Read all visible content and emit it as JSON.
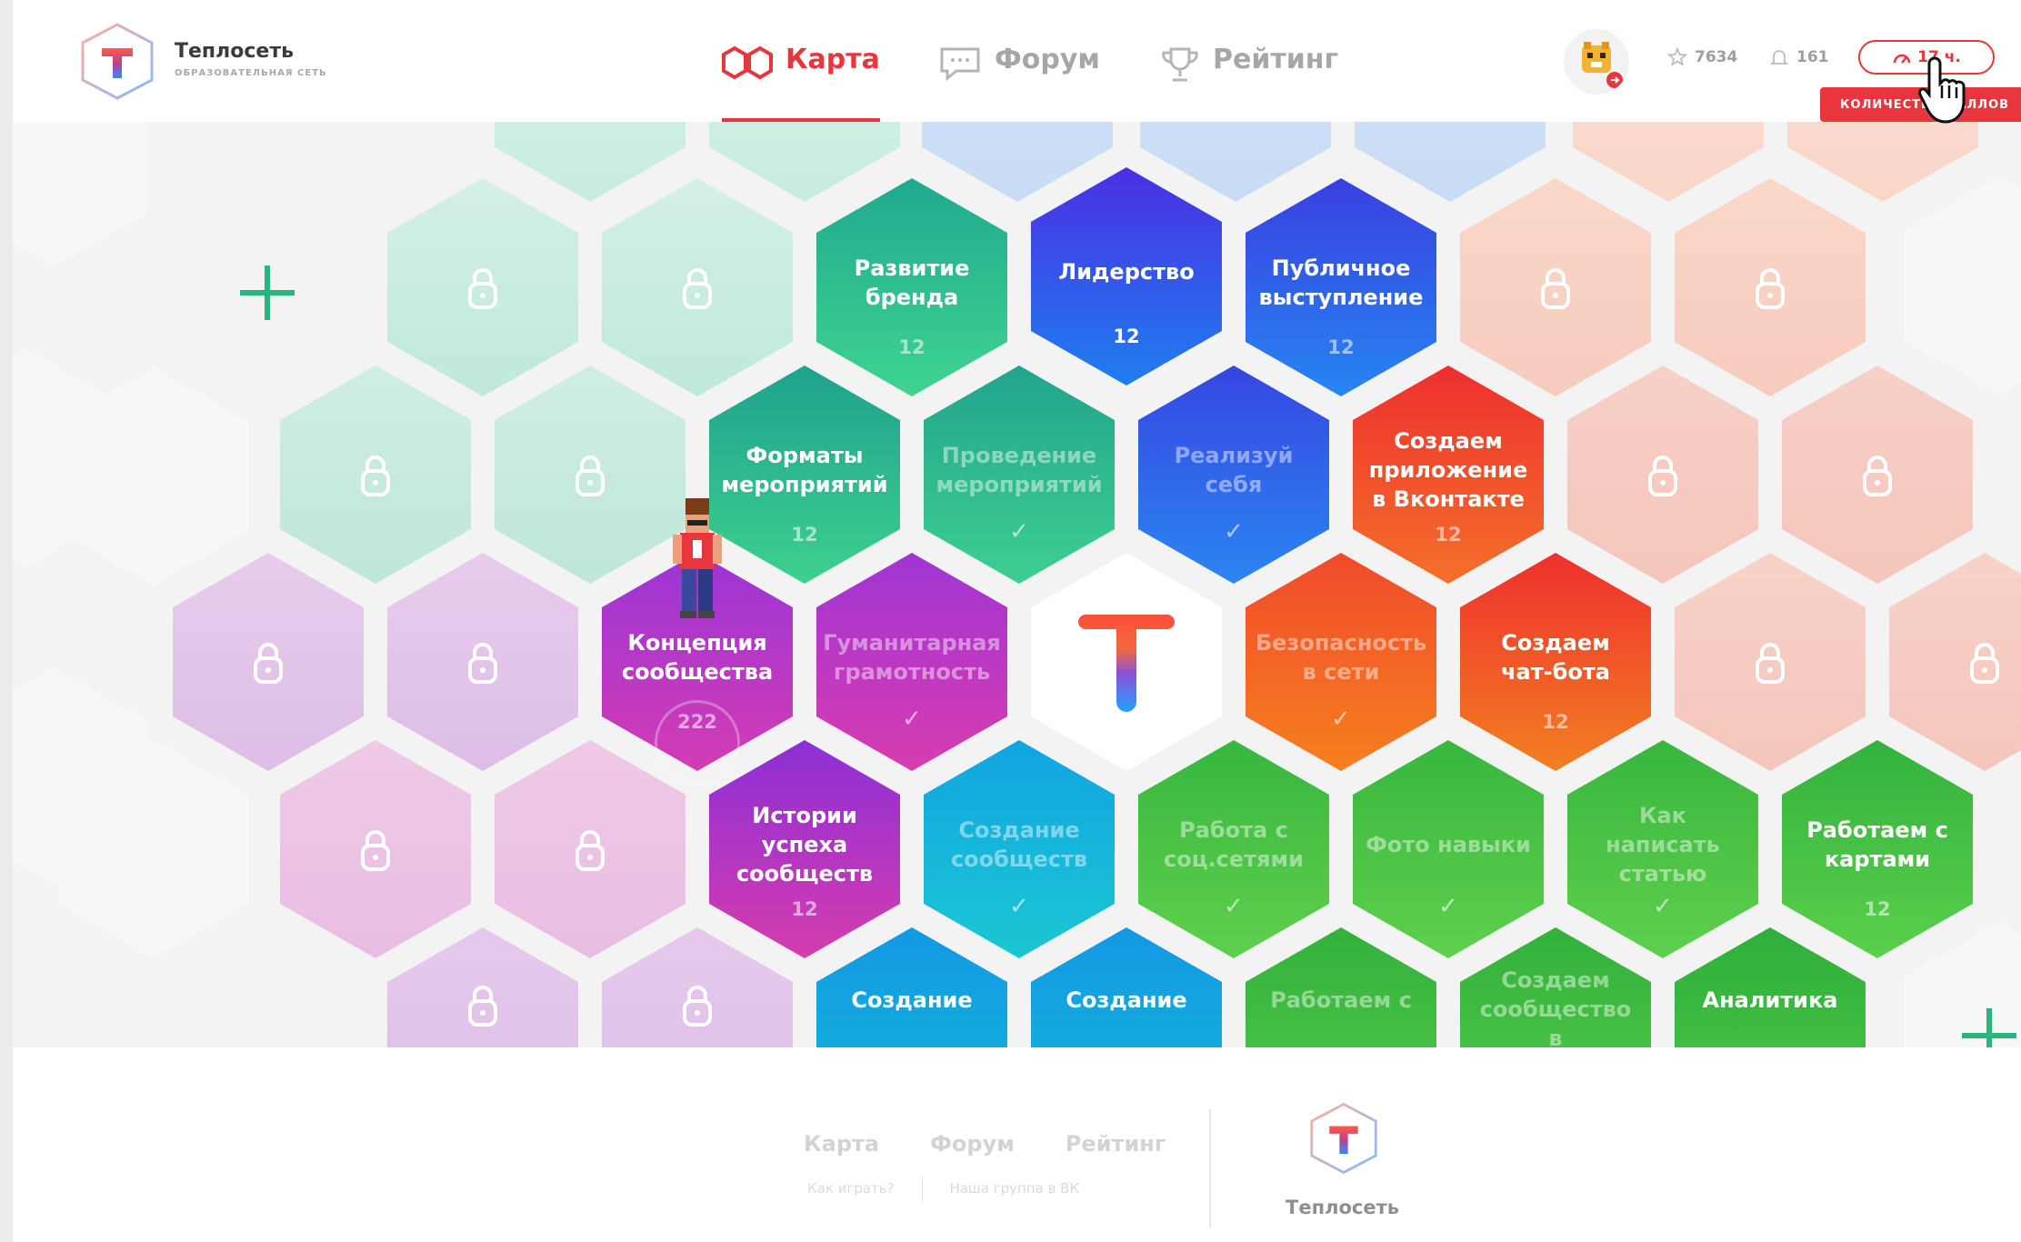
{
  "header": {
    "brand_name": "Теплосеть",
    "brand_sub": "ОБРАЗОВАТЕЛЬНАЯ СЕТЬ",
    "nav": [
      {
        "label": "Карта",
        "icon": "map-icon",
        "active": true
      },
      {
        "label": "Форум",
        "icon": "chat-icon",
        "active": false
      },
      {
        "label": "Рейтинг",
        "icon": "trophy-icon",
        "active": false
      }
    ],
    "stars": "7634",
    "notifications": "161",
    "time_label": "17 ч.",
    "tooltip": "количество баллов"
  },
  "map": {
    "center_logo": "teplonet-logo",
    "tiles": [
      {
        "label": "Развитие бренда",
        "count": "12",
        "state": "active"
      },
      {
        "label": "Лидерство",
        "count": "12",
        "state": "active"
      },
      {
        "label": "Публичное выступление",
        "count": "12",
        "state": "active"
      },
      {
        "label": "Форматы мероприятий",
        "count": "12",
        "state": "active"
      },
      {
        "label": "Проведение мероприятий",
        "state": "done"
      },
      {
        "label": "Реализуй себя",
        "state": "done"
      },
      {
        "label": "Создаем приложение в Вконтакте",
        "count": "12",
        "state": "active"
      },
      {
        "label": "Концепция сообщества",
        "count": "222",
        "state": "active"
      },
      {
        "label": "Гуманитарная грамотность",
        "state": "done"
      },
      {
        "label": "Безопасность в сети",
        "state": "done"
      },
      {
        "label": "Создаем чат-бота",
        "count": "12",
        "state": "active"
      },
      {
        "label": "Истории успеха сообществ",
        "count": "12",
        "state": "active"
      },
      {
        "label": "Создание сообществ",
        "state": "done"
      },
      {
        "label": "Работа с соц.сетями",
        "state": "done"
      },
      {
        "label": "Фото навыки",
        "state": "done"
      },
      {
        "label": "Как написать статью",
        "state": "done"
      },
      {
        "label": "Работаем с картами",
        "count": "12",
        "state": "active"
      },
      {
        "label": "Создание",
        "state": "active"
      },
      {
        "label": "Создание",
        "state": "active"
      },
      {
        "label": "Работаем с",
        "state": "done"
      },
      {
        "label": "Создаем сообщество в",
        "state": "done"
      },
      {
        "label": "Аналитика",
        "state": "active"
      }
    ],
    "colors": {
      "teal": "#2bbf8f",
      "blue": "#3b5bea",
      "orange": "#f0502c",
      "purple": "#b43ad0",
      "cyan": "#14b6dc",
      "green": "#3fc24b",
      "accent": "#e8353e"
    }
  },
  "footer": {
    "links": [
      "Карта",
      "Форум",
      "Рейтинг"
    ],
    "sublinks": [
      "Как играть?",
      "Наша группа в ВК"
    ],
    "brand": "Теплосеть"
  }
}
